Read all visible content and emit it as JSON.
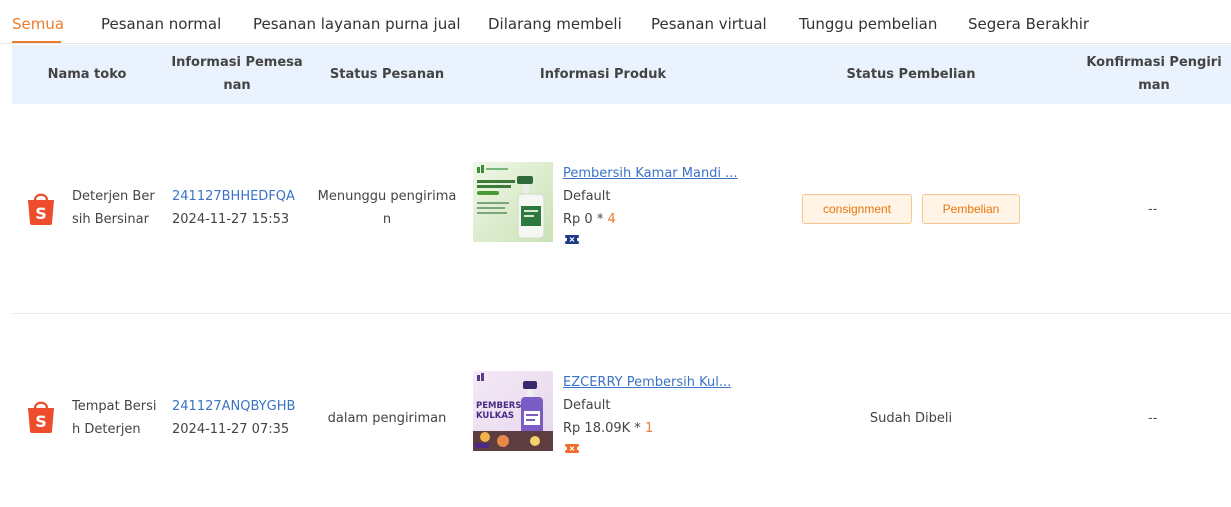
{
  "tabs": [
    {
      "label": "Semua"
    },
    {
      "label": "Pesanan normal"
    },
    {
      "label": "Pesanan layanan purna jual"
    },
    {
      "label": "Dilarang membeli"
    },
    {
      "label": "Pesanan virtual"
    },
    {
      "label": "Tunggu pembelian"
    },
    {
      "label": "Segera Berakhir"
    }
  ],
  "columns": {
    "shop_l1": "Nama toko",
    "order_l1": "Informasi Pemesa",
    "order_l2": "nan",
    "status": "Status Pesanan",
    "product": "Informasi Produk",
    "purchase": "Status Pembelian",
    "confirm_l1": "Konfirmasi Pengiri",
    "confirm_l2": "man"
  },
  "rows": [
    {
      "shop_l1": "Deterjen Ber",
      "shop_l2": "sih Bersinar",
      "order_id": "241127BHHEDFQA",
      "order_time": "2024-11-27 15:53",
      "status_l1": "Menunggu pengirima",
      "status_l2": "n",
      "product_title": "Pembersih Kamar Mandi ...",
      "variant": "Default",
      "price": "Rp 0 * ",
      "qty": "4",
      "ticket_color": "#1f3a8a",
      "btn_consignment": "consignment",
      "btn_pembelian": "Pembelian",
      "confirm": "--"
    },
    {
      "shop_l1": "Tempat Bersi",
      "shop_l2": "h Deterjen",
      "order_id": "241127ANQBYGHB",
      "order_time": "2024-11-27 07:35",
      "status_l1": "dalam pengiriman",
      "product_title": "EZCERRY Pembersih Kul...",
      "variant": "Default",
      "price": "Rp 18.09K * ",
      "qty": "1",
      "ticket_color": "#f06a2a",
      "purchase_status": "Sudah Dibeli",
      "confirm": "--"
    }
  ],
  "colors": {
    "accent": "#ee7b2c",
    "link": "#3b73c6",
    "header_bg": "#eaf2fd",
    "shopee_orange": "#ee4d2d"
  },
  "icons": {
    "shop": "shopee-bag-icon",
    "ticket": "ticket-icon"
  }
}
